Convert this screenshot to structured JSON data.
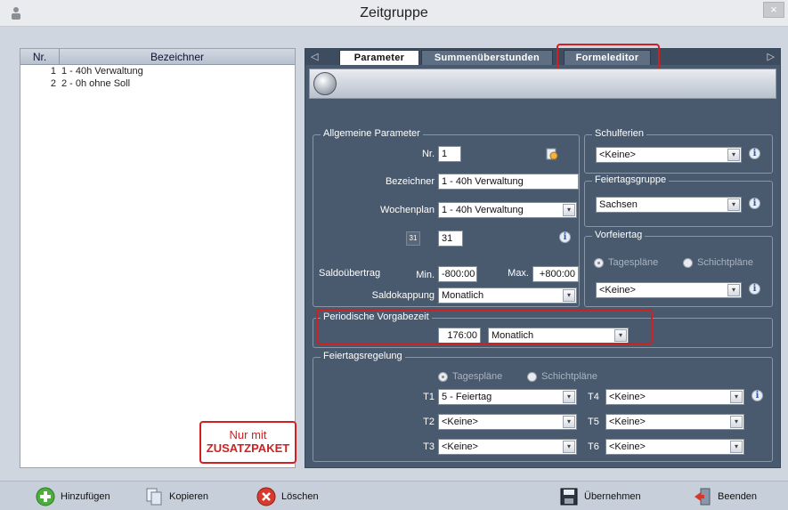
{
  "window": {
    "title": "Zeitgruppe",
    "close_glyph": "×"
  },
  "list": {
    "headers": {
      "nr": "Nr.",
      "bezeichner": "Bezeichner"
    },
    "rows": [
      {
        "nr": "1",
        "bezeichner": "1 - 40h Verwaltung"
      },
      {
        "nr": "2",
        "bezeichner": "2 - 0h ohne Soll"
      }
    ]
  },
  "promo": {
    "line1": "Nur mit",
    "line2": "ZUSATZPAKET",
    "color": "#d21f1f"
  },
  "tabs": [
    {
      "label": "Parameter",
      "active": true
    },
    {
      "label": "Summenüberstunden",
      "active": false
    },
    {
      "label": "Formeleditor",
      "active": false
    }
  ],
  "tab_arrows": {
    "left": "◁",
    "right": "▷"
  },
  "allgemeine": {
    "legend": "Allgemeine Parameter",
    "nr_label": "Nr.",
    "nr_value": "1",
    "bezeichner_label": "Bezeichner",
    "bezeichner_value": "1 - 40h Verwaltung",
    "wochenplan_label": "Wochenplan",
    "wochenplan_value": "1 - 40h Verwaltung",
    "days_value": "31",
    "calendar_icon_text": "31",
    "saldouebertrag_label": "Saldoübertrag",
    "min_label": "Min.",
    "min_value": "-800:00",
    "max_label": "Max.",
    "max_value": "+800:00",
    "saldokappung_label": "Saldokappung",
    "saldokappung_value": "Monatlich"
  },
  "schulferien": {
    "legend": "Schulferien",
    "value": "<Keine>"
  },
  "feiertagsgruppe": {
    "legend": "Feiertagsgruppe",
    "value": "Sachsen"
  },
  "vorfeiertag": {
    "legend": "Vorfeiertag",
    "radio1": "Tagespläne",
    "radio2": "Schichtpläne",
    "value": "<Keine>"
  },
  "periodische": {
    "legend": "Periodische Vorgabezeit",
    "time_value": "176:00",
    "period_value": "Monatlich"
  },
  "feiertagsregelung": {
    "legend": "Feiertagsregelung",
    "radio1": "Tagespläne",
    "radio2": "Schichtpläne",
    "t1_label": "T1",
    "t1_value": "5 - Feiertag",
    "t2_label": "T2",
    "t2_value": "<Keine>",
    "t3_label": "T3",
    "t3_value": "<Keine>",
    "t4_label": "T4",
    "t4_value": "<Keine>",
    "t5_label": "T5",
    "t5_value": "<Keine>",
    "t6_label": "T6",
    "t6_value": "<Keine>"
  },
  "info_glyph": "i",
  "combo_glyph": "▾",
  "bottom": {
    "hinzufuegen": "Hinzufügen",
    "kopieren": "Kopieren",
    "loeschen": "Löschen",
    "uebernehmen": "Übernehmen",
    "beenden": "Beenden"
  },
  "colors": {
    "highlight": "#d21f1f",
    "panel": "#4a5a6e"
  }
}
